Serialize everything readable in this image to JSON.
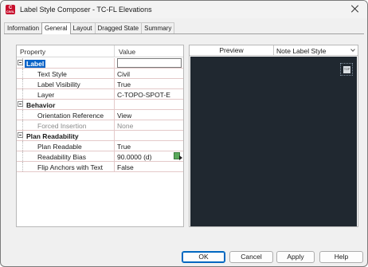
{
  "window": {
    "title": "Label Style Composer - TC-FL Elevations",
    "app_icon_line1": "C",
    "app_icon_line2": "CIVIL"
  },
  "tabs": [
    {
      "label": "Information",
      "active": false
    },
    {
      "label": "General",
      "active": true
    },
    {
      "label": "Layout",
      "active": false
    },
    {
      "label": "Dragged State",
      "active": false
    },
    {
      "label": "Summary",
      "active": false
    }
  ],
  "grid": {
    "headers": {
      "property": "Property",
      "value": "Value"
    },
    "sections": [
      {
        "label": "Label",
        "value": "",
        "selected": true,
        "items": [
          {
            "label": "Text Style",
            "value": "Civil"
          },
          {
            "label": "Label Visibility",
            "value": "True"
          },
          {
            "label": "Layer",
            "value": "C-TOPO-SPOT-E"
          }
        ]
      },
      {
        "label": "Behavior",
        "value": "",
        "items": [
          {
            "label": "Orientation Reference",
            "value": "View",
            "disabled": false
          },
          {
            "label": "Forced Insertion",
            "value": "None",
            "disabled": true
          }
        ]
      },
      {
        "label": "Plan Readability",
        "value": "",
        "items": [
          {
            "label": "Plan Readable",
            "value": "True"
          },
          {
            "label": "Readability Bias",
            "value": "90.0000 (d)"
          },
          {
            "label": "Flip Anchors with Text",
            "value": "False"
          }
        ]
      }
    ]
  },
  "preview": {
    "label": "Preview",
    "style_select_value": "Note Label Style",
    "view_cube_label": "TOP"
  },
  "buttons": {
    "ok": "OK",
    "cancel": "Cancel",
    "apply": "Apply",
    "help": "Help"
  },
  "colors": {
    "selection": "#0a64c8",
    "viewport_background": "#202830",
    "row_divider": "#e4c9c9"
  }
}
